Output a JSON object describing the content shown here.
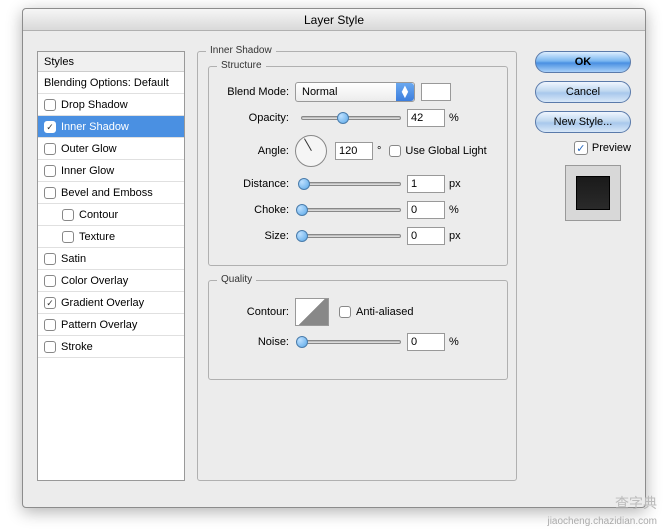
{
  "window": {
    "title": "Layer Style"
  },
  "styles_panel": {
    "header": "Styles",
    "blending_label": "Blending Options: Default",
    "items": [
      {
        "label": "Drop Shadow",
        "checked": false
      },
      {
        "label": "Inner Shadow",
        "checked": true,
        "selected": true
      },
      {
        "label": "Outer Glow",
        "checked": false
      },
      {
        "label": "Inner Glow",
        "checked": false
      },
      {
        "label": "Bevel and Emboss",
        "checked": false
      },
      {
        "label": "Contour",
        "checked": false,
        "indent": true
      },
      {
        "label": "Texture",
        "checked": false,
        "indent": true
      },
      {
        "label": "Satin",
        "checked": false
      },
      {
        "label": "Color Overlay",
        "checked": false
      },
      {
        "label": "Gradient Overlay",
        "checked": true
      },
      {
        "label": "Pattern Overlay",
        "checked": false
      },
      {
        "label": "Stroke",
        "checked": false
      }
    ]
  },
  "main": {
    "title": "Inner Shadow",
    "structure": {
      "title": "Structure",
      "blend_mode_label": "Blend Mode:",
      "blend_mode_value": "Normal",
      "opacity_label": "Opacity:",
      "opacity_value": "42",
      "opacity_unit": "%",
      "angle_label": "Angle:",
      "angle_value": "120",
      "angle_unit": "°",
      "global_light_label": "Use Global Light",
      "distance_label": "Distance:",
      "distance_value": "1",
      "distance_unit": "px",
      "choke_label": "Choke:",
      "choke_value": "0",
      "choke_unit": "%",
      "size_label": "Size:",
      "size_value": "0",
      "size_unit": "px"
    },
    "quality": {
      "title": "Quality",
      "contour_label": "Contour:",
      "antialias_label": "Anti-aliased",
      "noise_label": "Noise:",
      "noise_value": "0",
      "noise_unit": "%"
    }
  },
  "buttons": {
    "ok": "OK",
    "cancel": "Cancel",
    "new_style": "New Style...",
    "preview_label": "Preview"
  },
  "watermark": {
    "line1": "查字典",
    "line2": "jiaocheng.chazidian.com"
  }
}
